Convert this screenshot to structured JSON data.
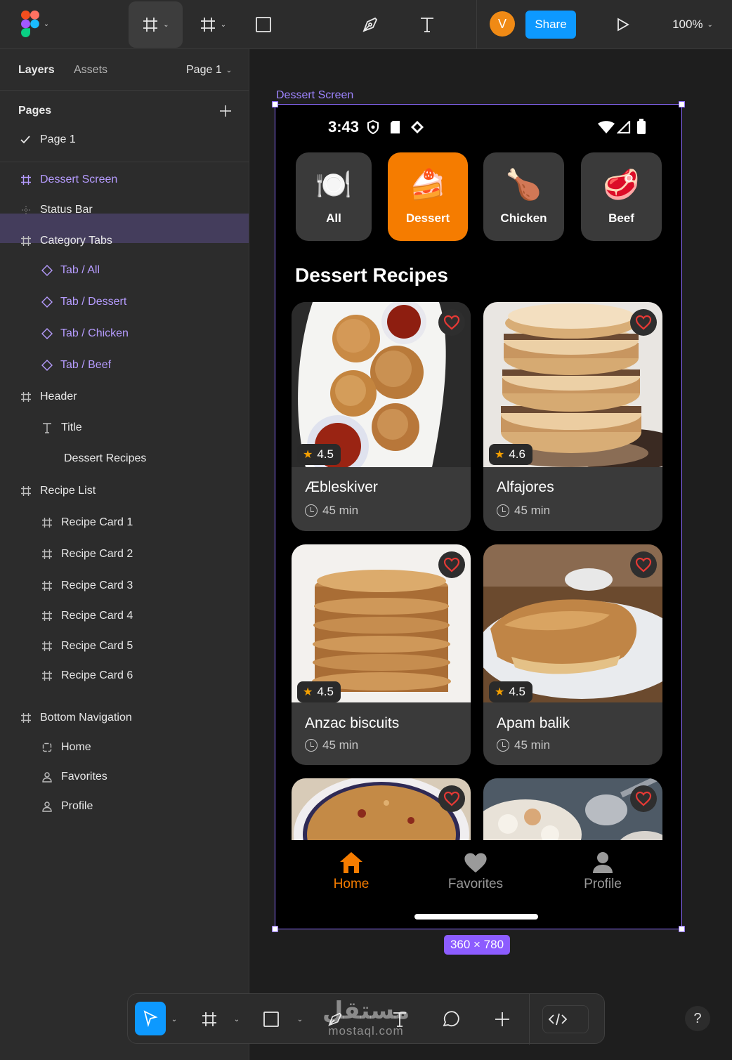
{
  "toolbar": {
    "avatar_initial": "V",
    "share_label": "Share",
    "zoom_label": "100%"
  },
  "left_panel": {
    "tabs": {
      "layers": "Layers",
      "assets": "Assets"
    },
    "page_selector": "Page 1",
    "pages_header": "Pages",
    "pages": [
      "Page 1"
    ],
    "layers": [
      {
        "label": "Dessert Screen",
        "icon": "frame-icon",
        "selected": true
      },
      {
        "label": "Status Bar",
        "icon": "dotted-frame-icon"
      },
      {
        "label": "Category Tabs",
        "icon": "frame-icon"
      },
      {
        "label": "Tab / All",
        "icon": "component-instance-icon"
      },
      {
        "label": "Tab / Dessert",
        "icon": "component-instance-icon"
      },
      {
        "label": "Tab / Chicken",
        "icon": "component-instance-icon"
      },
      {
        "label": "Tab / Beef",
        "icon": "component-instance-icon"
      },
      {
        "label": "Header",
        "icon": "frame-icon"
      },
      {
        "label": "Title",
        "icon": "text-icon"
      },
      {
        "label": "Dessert Recipes",
        "icon": "none"
      },
      {
        "label": "Recipe List",
        "icon": "frame-icon"
      },
      {
        "label": "Recipe Card 1",
        "icon": "frame-icon"
      },
      {
        "label": "Recipe Card 2",
        "icon": "frame-icon"
      },
      {
        "label": "Recipe Card 3",
        "icon": "frame-icon"
      },
      {
        "label": "Recipe Card 4",
        "icon": "frame-icon"
      },
      {
        "label": "Recipe Card 5",
        "icon": "frame-icon"
      },
      {
        "label": "Recipe Card 6",
        "icon": "frame-icon"
      },
      {
        "label": "Bottom Navigation",
        "icon": "frame-icon"
      },
      {
        "label": "Home",
        "icon": "home-outline-icon"
      },
      {
        "label": "Favorites",
        "icon": "person-outline-icon"
      },
      {
        "label": "Profile",
        "icon": "person-outline-icon"
      }
    ]
  },
  "canvas": {
    "frame_label": "Dessert Screen",
    "size_badge": "360 × 780"
  },
  "app": {
    "status_time": "3:43",
    "tabs": [
      {
        "label": "All",
        "emoji": "🍽️",
        "active": false
      },
      {
        "label": "Dessert",
        "emoji": "🍰",
        "active": true
      },
      {
        "label": "Chicken",
        "emoji": "🍗",
        "active": false
      },
      {
        "label": "Beef",
        "emoji": "🥩",
        "active": false
      }
    ],
    "section_title": "Dessert Recipes",
    "recipes": [
      {
        "name": "Æbleskiver",
        "rating": "4.5",
        "duration": "45 min"
      },
      {
        "name": "Alfajores",
        "rating": "4.6",
        "duration": "45 min"
      },
      {
        "name": "Anzac biscuits",
        "rating": "4.5",
        "duration": "45 min"
      },
      {
        "name": "Apam balik",
        "rating": "4.5",
        "duration": "45 min"
      },
      {
        "name": "",
        "rating": "",
        "duration": ""
      },
      {
        "name": "",
        "rating": "",
        "duration": ""
      }
    ],
    "nav": [
      {
        "label": "Home",
        "active": true
      },
      {
        "label": "Favorites",
        "active": false
      },
      {
        "label": "Profile",
        "active": false
      }
    ]
  },
  "watermark": {
    "arabic": "مستقل",
    "latin": "mostaql.com"
  },
  "colors": {
    "accent_orange": "#f57c00",
    "figma_blue": "#0d99ff",
    "selection_purple": "#8c6bff",
    "heart_red": "#e53935"
  }
}
